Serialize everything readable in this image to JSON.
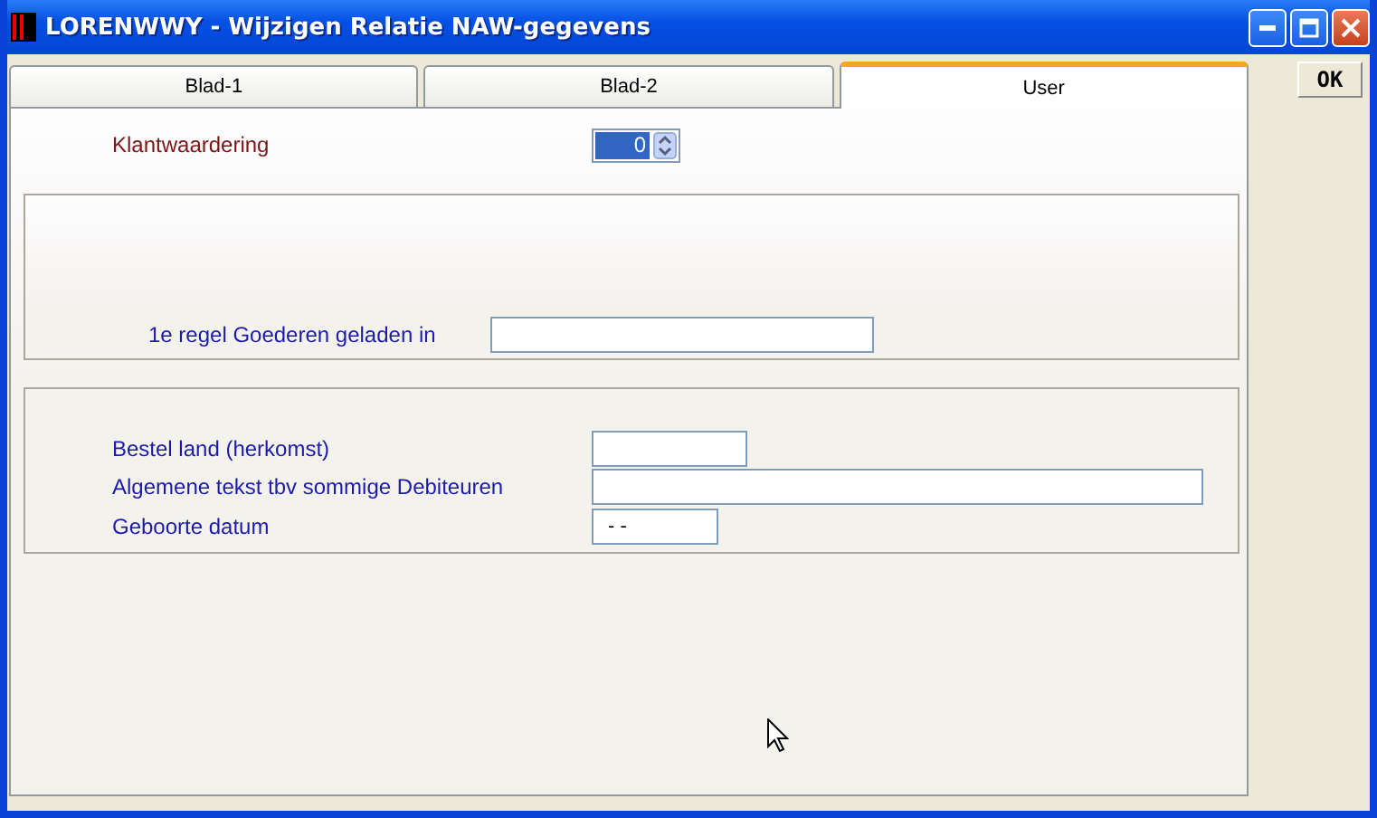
{
  "window": {
    "title": "LORENWWY - Wijzigen Relatie NAW-gegevens"
  },
  "tabs": [
    {
      "label": "Blad-1",
      "selected": false
    },
    {
      "label": "Blad-2",
      "selected": false
    },
    {
      "label": "User",
      "selected": true
    }
  ],
  "ok_button": "OK",
  "rating": {
    "label": "Klantwaardering",
    "value": "0"
  },
  "group_1": {
    "fields": [
      {
        "label": "1e regel Goederen geladen in"
      }
    ]
  },
  "group_2": {
    "fields": [
      {
        "label": "Bestel land (herkomst)",
        "kind": "short"
      },
      {
        "label": "Algemene tekst tbv sommige Debiteuren",
        "kind": "long"
      },
      {
        "label": "Geboorte datum",
        "kind": "date",
        "value": "- -"
      }
    ]
  }
}
